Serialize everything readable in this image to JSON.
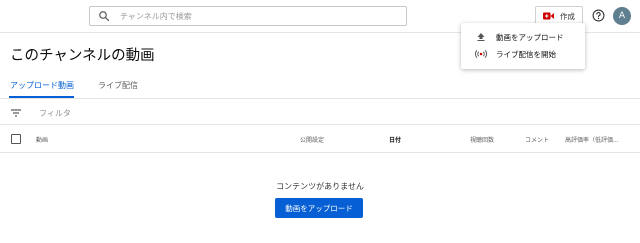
{
  "search": {
    "placeholder": "チャンネル内で検索",
    "icon": "search-icon"
  },
  "header": {
    "create_label": "作成",
    "avatar_letter": "A",
    "colors": {
      "create_icon": "#cc0000",
      "avatar_bg": "#5f7e8f"
    }
  },
  "menu": {
    "items": [
      {
        "label": "動画をアップロード",
        "icon": "upload-icon"
      },
      {
        "label": "ライブ配信を開始",
        "icon": "live-broadcast-icon"
      }
    ]
  },
  "page": {
    "title": "このチャンネルの動画"
  },
  "tabs": [
    {
      "label": "アップロード動画",
      "active": true
    },
    {
      "label": "ライブ配信",
      "active": false
    }
  ],
  "filter": {
    "label": "フィルタ"
  },
  "table": {
    "columns": [
      "動画",
      "公開設定",
      "日付",
      "視聴回数",
      "コメント",
      "高評価率（低評価..."
    ]
  },
  "empty_state": {
    "message": "コンテンツがありません",
    "button_label": "動画をアップロード"
  },
  "colors": {
    "accent": "#065fd4"
  }
}
